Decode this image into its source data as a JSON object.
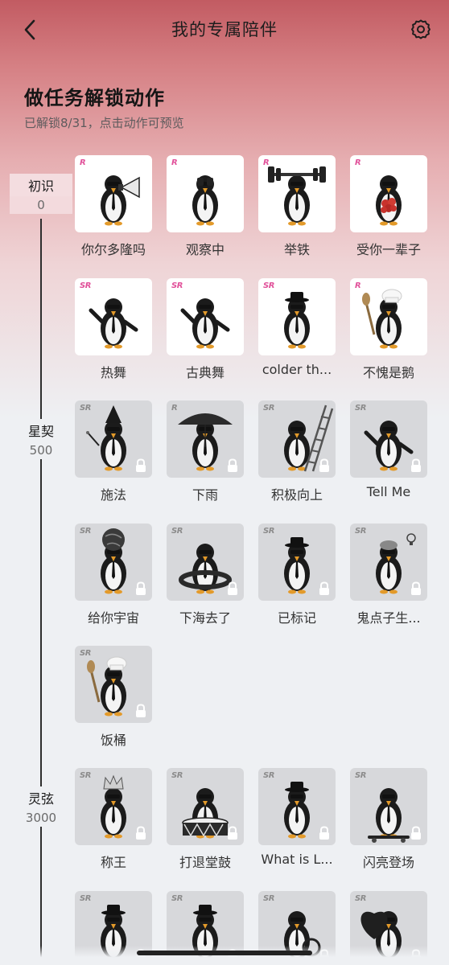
{
  "nav": {
    "title": "我的专属陪伴"
  },
  "header": {
    "title": "做任务解锁动作",
    "subtitle": "已解锁8/31，点击动作可预览"
  },
  "tiers": [
    {
      "name": "初识",
      "score": "0"
    },
    {
      "name": "星契",
      "score": "500"
    },
    {
      "name": "灵弦",
      "score": "3000"
    }
  ],
  "actions": [
    {
      "label": "你尔多隆吗",
      "rarity": "R",
      "locked": false,
      "prop": "megaphone"
    },
    {
      "label": "观察中",
      "rarity": "R",
      "locked": false,
      "prop": "binoculars"
    },
    {
      "label": "举铁",
      "rarity": "R",
      "locked": false,
      "prop": "barbell"
    },
    {
      "label": "受你一辈子",
      "rarity": "R",
      "locked": false,
      "prop": "flowers"
    },
    {
      "label": "热舞",
      "rarity": "SR",
      "locked": false,
      "prop": "dance"
    },
    {
      "label": "古典舞",
      "rarity": "SR",
      "locked": false,
      "prop": "dance"
    },
    {
      "label": "colder th...",
      "rarity": "SR",
      "locked": false,
      "prop": "hat"
    },
    {
      "label": "不愧是鹅",
      "rarity": "R",
      "locked": false,
      "prop": "chef"
    },
    {
      "label": "施法",
      "rarity": "SR",
      "locked": true,
      "prop": "wizard"
    },
    {
      "label": "下雨",
      "rarity": "R",
      "locked": true,
      "prop": "umbrella"
    },
    {
      "label": "积极向上",
      "rarity": "SR",
      "locked": true,
      "prop": "ladder"
    },
    {
      "label": "Tell Me",
      "rarity": "SR",
      "locked": true,
      "prop": "dance"
    },
    {
      "label": "给你宇宙",
      "rarity": "SR",
      "locked": true,
      "prop": "globe"
    },
    {
      "label": "下海去了",
      "rarity": "SR",
      "locked": true,
      "prop": "swim"
    },
    {
      "label": "已标记",
      "rarity": "SR",
      "locked": true,
      "prop": "hat"
    },
    {
      "label": "鬼点子生...",
      "rarity": "SR",
      "locked": true,
      "prop": "bulb"
    },
    {
      "label": "饭桶",
      "rarity": "SR",
      "locked": true,
      "prop": "chef"
    },
    {
      "label": "称王",
      "rarity": "SR",
      "locked": true,
      "prop": "crown"
    },
    {
      "label": "打退堂鼓",
      "rarity": "SR",
      "locked": true,
      "prop": "drum"
    },
    {
      "label": "What is L...",
      "rarity": "SR",
      "locked": true,
      "prop": "hat"
    },
    {
      "label": "闪亮登场",
      "rarity": "SR",
      "locked": true,
      "prop": "skate"
    },
    {
      "label": "",
      "rarity": "SR",
      "locked": true,
      "prop": "hat"
    },
    {
      "label": "",
      "rarity": "SR",
      "locked": true,
      "prop": "hat"
    },
    {
      "label": "",
      "rarity": "SR",
      "locked": true,
      "prop": "magnifier"
    },
    {
      "label": "",
      "rarity": "SR",
      "locked": true,
      "prop": "heart"
    }
  ]
}
